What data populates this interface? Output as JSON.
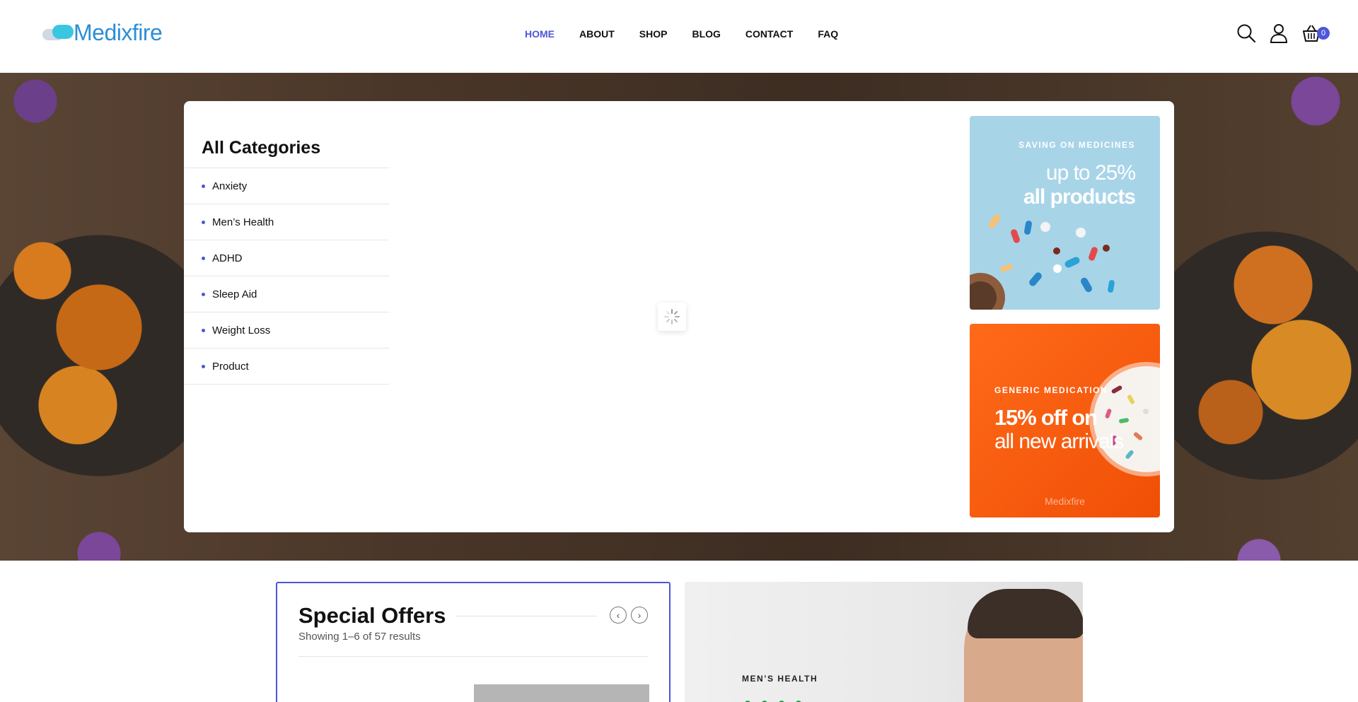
{
  "header": {
    "logo_text": "Medixfire",
    "nav": [
      {
        "label": "HOME",
        "active": true
      },
      {
        "label": "ABOUT",
        "active": false
      },
      {
        "label": "SHOP",
        "active": false
      },
      {
        "label": "BLOG",
        "active": false
      },
      {
        "label": "CONTACT",
        "active": false
      },
      {
        "label": "FAQ",
        "active": false
      }
    ],
    "icons": [
      "search-icon",
      "user-icon",
      "basket-icon"
    ],
    "cart_count": "0"
  },
  "hero": {
    "categories_title": "All Categories",
    "categories": [
      "Anxiety",
      "Men’s Health",
      "ADHD",
      "Sleep Aid",
      "Weight Loss",
      "Product"
    ],
    "banner1": {
      "eyebrow": "SAVING ON MEDICINES",
      "line1": "up to 25%",
      "line2": "all products"
    },
    "banner2": {
      "eyebrow": "GENERIC MEDICATION",
      "line1": "15% off on",
      "line2": "all new arrivals",
      "brand": "Medixfire"
    }
  },
  "special_offers": {
    "title": "Special Offers",
    "results": "Showing 1–6 of 57 results"
  },
  "promo": {
    "eyebrow": "MEN’S HEALTH"
  },
  "colors": {
    "accent": "#4d56d9",
    "logo": "#2c8ed6",
    "banner_blue": "#a8d4e8",
    "banner_orange": "#f25a0c"
  }
}
